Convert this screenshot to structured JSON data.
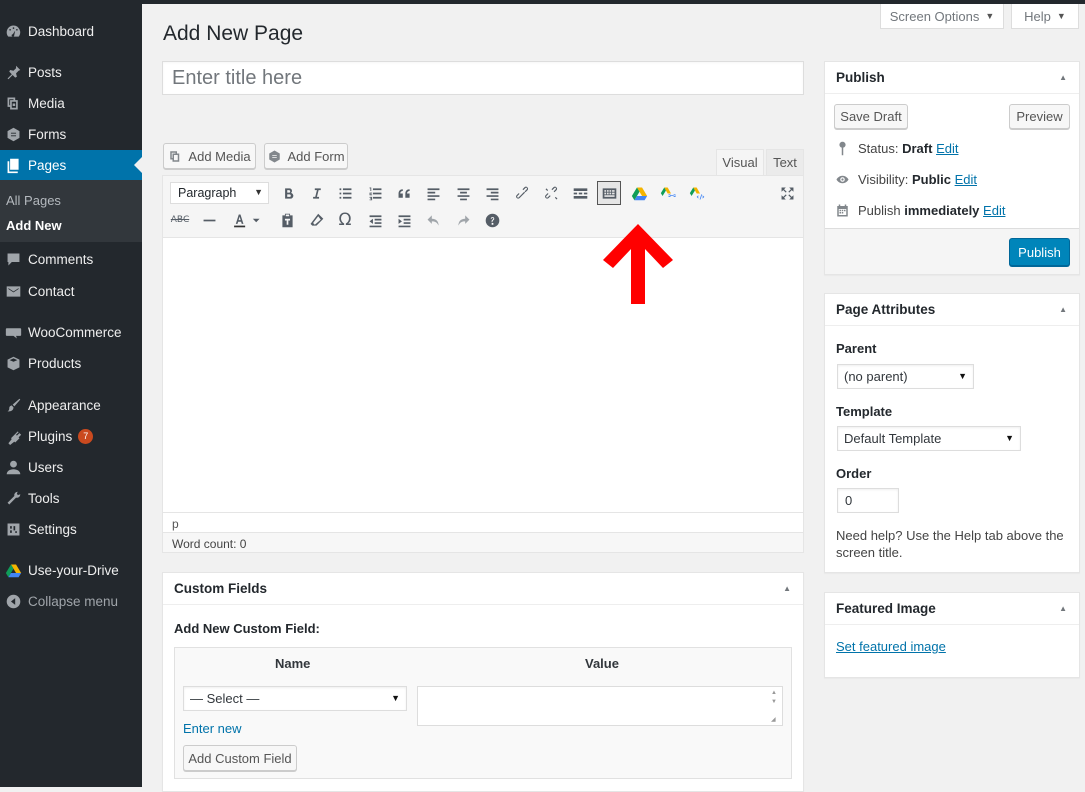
{
  "sidebar": {
    "items": [
      {
        "label": "Dashboard",
        "icon": "dashboard-icon"
      },
      {
        "label": "Posts",
        "icon": "pin-icon"
      },
      {
        "label": "Media",
        "icon": "media-icon"
      },
      {
        "label": "Forms",
        "icon": "forms-icon"
      },
      {
        "label": "Pages",
        "icon": "pages-icon",
        "active": true
      },
      {
        "label": "Comments",
        "icon": "comments-icon"
      },
      {
        "label": "Contact",
        "icon": "mail-icon"
      },
      {
        "label": "WooCommerce",
        "icon": "woocommerce-icon"
      },
      {
        "label": "Products",
        "icon": "products-icon"
      },
      {
        "label": "Appearance",
        "icon": "paintbrush-icon"
      },
      {
        "label": "Plugins",
        "icon": "plugin-icon",
        "badge": "7"
      },
      {
        "label": "Users",
        "icon": "users-icon"
      },
      {
        "label": "Tools",
        "icon": "wrench-icon"
      },
      {
        "label": "Settings",
        "icon": "settings-icon"
      },
      {
        "label": "Use-your-Drive",
        "icon": "google-drive-icon"
      },
      {
        "label": "Collapse menu",
        "icon": "collapse-icon"
      }
    ],
    "submenu": [
      {
        "label": "All Pages"
      },
      {
        "label": "Add New",
        "current": true
      }
    ]
  },
  "header": {
    "screen_options": "Screen Options",
    "help": "Help",
    "title": "Add New Page"
  },
  "editor": {
    "title_placeholder": "Enter title here",
    "add_media": "Add Media",
    "add_form": "Add Form",
    "tab_visual": "Visual",
    "tab_text": "Text",
    "format": "Paragraph",
    "path": "p",
    "word_count": "Word count: 0"
  },
  "custom_fields": {
    "title": "Custom Fields",
    "add_new_label": "Add New Custom Field:",
    "col_name": "Name",
    "col_value": "Value",
    "select_placeholder": "— Select —",
    "enter_new": "Enter new",
    "add_button": "Add Custom Field"
  },
  "publish": {
    "title": "Publish",
    "save_draft": "Save Draft",
    "preview": "Preview",
    "status_label": "Status:",
    "status_value": "Draft",
    "visibility_label": "Visibility:",
    "visibility_value": "Public",
    "schedule_label": "Publish",
    "schedule_value": "immediately",
    "edit": "Edit",
    "publish_button": "Publish"
  },
  "page_attributes": {
    "title": "Page Attributes",
    "parent_label": "Parent",
    "parent_value": "(no parent)",
    "template_label": "Template",
    "template_value": "Default Template",
    "order_label": "Order",
    "order_value": "0",
    "help_text": "Need help? Use the Help tab above the screen title."
  },
  "featured_image": {
    "title": "Featured Image",
    "link": "Set featured image"
  },
  "colors": {
    "sidebar_bg": "#23282d",
    "active_blue": "#0073aa",
    "primary_button": "#0085ba",
    "annotation_arrow": "#ff0000"
  }
}
